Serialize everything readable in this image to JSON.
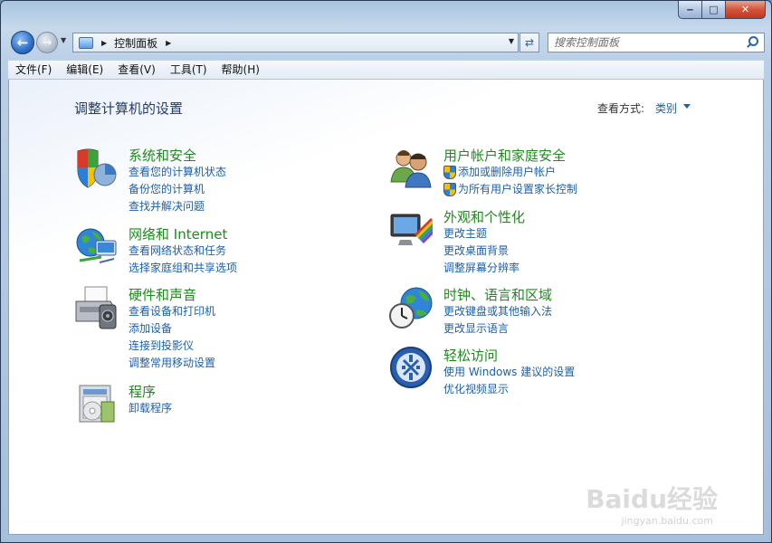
{
  "window": {
    "caption": {
      "minimize": "‒",
      "maximize": "□",
      "close": "✕"
    }
  },
  "address_bar": {
    "path": "控制面板",
    "search_placeholder": "搜索控制面板"
  },
  "menu": [
    {
      "label": "文件(F)"
    },
    {
      "label": "编辑(E)"
    },
    {
      "label": "查看(V)"
    },
    {
      "label": "工具(T)"
    },
    {
      "label": "帮助(H)"
    }
  ],
  "content": {
    "title": "调整计算机的设置",
    "view_by_label": "查看方式:",
    "view_by_value": "类别"
  },
  "categories": {
    "system": {
      "icon": "shield-icon",
      "title": "系统和安全",
      "links": [
        "查看您的计算机状态",
        "备份您的计算机",
        "查找并解决问题"
      ]
    },
    "network": {
      "icon": "globe-network-icon",
      "title": "网络和 Internet",
      "links": [
        "查看网络状态和任务",
        "选择家庭组和共享选项"
      ]
    },
    "hardware": {
      "icon": "printer-icon",
      "title": "硬件和声音",
      "links": [
        "查看设备和打印机",
        "添加设备",
        "连接到投影仪",
        "调整常用移动设置"
      ]
    },
    "programs": {
      "icon": "programs-icon",
      "title": "程序",
      "links": [
        "卸载程序"
      ]
    },
    "users": {
      "icon": "users-icon",
      "title": "用户帐户和家庭安全",
      "links": [
        "添加或删除用户帐户",
        "为所有用户设置家长控制"
      ]
    },
    "appearance": {
      "icon": "monitor-palette-icon",
      "title": "外观和个性化",
      "links": [
        "更改主题",
        "更改桌面背景",
        "调整屏幕分辨率"
      ]
    },
    "clock": {
      "icon": "clock-globe-icon",
      "title": "时钟、语言和区域",
      "links": [
        "更改键盘或其他输入法",
        "更改显示语言"
      ]
    },
    "ease": {
      "icon": "ease-of-access-icon",
      "title": "轻松访问",
      "links": [
        "使用 Windows 建议的设置",
        "优化视频显示"
      ]
    }
  },
  "watermark": {
    "brand": "Baidu经验",
    "url": "jingyan.baidu.com"
  }
}
